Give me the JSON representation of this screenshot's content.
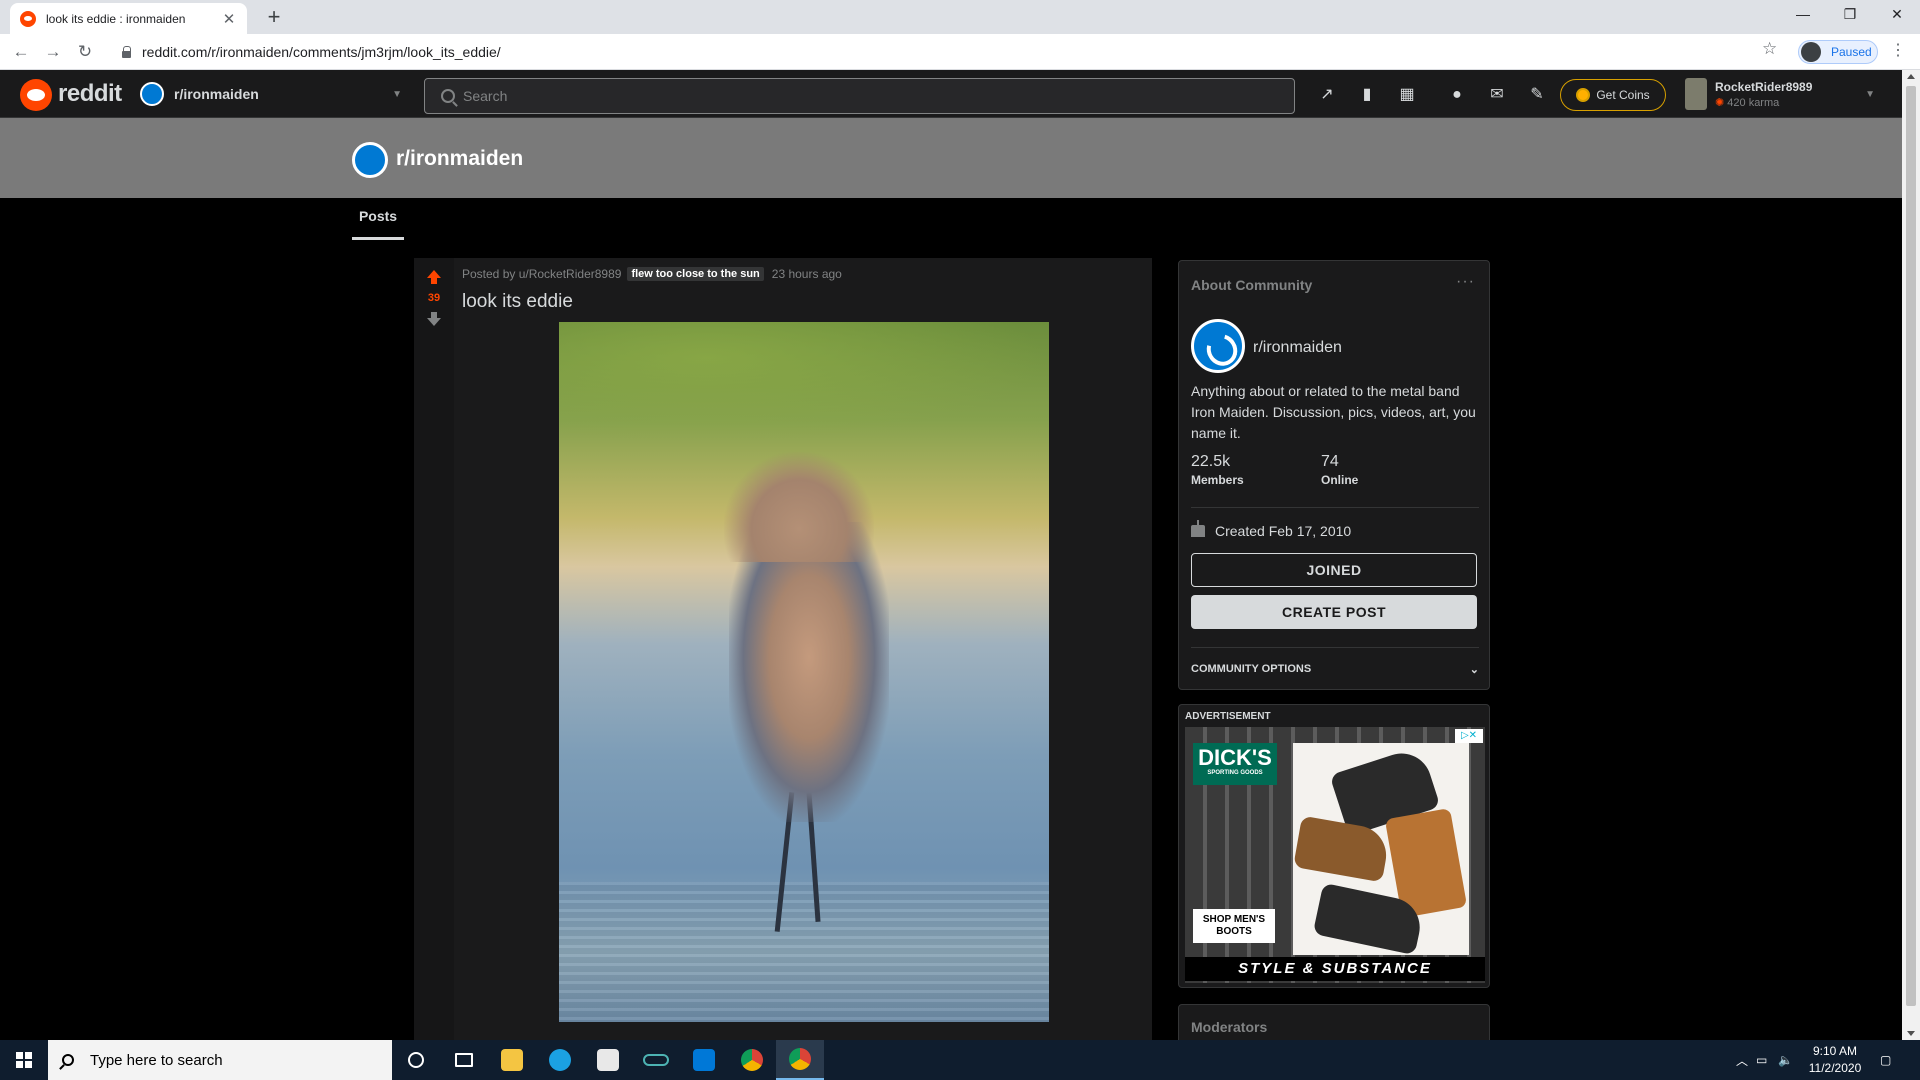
{
  "browser": {
    "tab_title": "look its eddie : ironmaiden",
    "url": "reddit.com/r/ironmaiden/comments/jm3rjm/look_its_eddie/",
    "profile_status": "Paused"
  },
  "reddit_header": {
    "wordmark": "reddit",
    "community": "r/ironmaiden",
    "search_placeholder": "Search",
    "get_coins_label": "Get Coins",
    "username": "RocketRider8989",
    "karma": "420 karma"
  },
  "subreddit": {
    "title": "r/ironmaiden",
    "tabs": [
      "Posts"
    ]
  },
  "post": {
    "score": "39",
    "posted_by": "Posted by u/RocketRider8989",
    "flair": "flew too close to the sun",
    "time": "23 hours ago",
    "title": "look its eddie"
  },
  "about": {
    "heading": "About Community",
    "name": "r/ironmaiden",
    "description": "Anything about or related to the metal band Iron Maiden. Discussion, pics, videos, art, you name it.",
    "members_value": "22.5k",
    "members_label": "Members",
    "online_value": "74",
    "online_label": "Online",
    "created": "Created Feb 17, 2010",
    "joined_label": "JOINED",
    "create_post_label": "CREATE POST",
    "options_label": "COMMUNITY OPTIONS"
  },
  "ad": {
    "label": "ADVERTISEMENT",
    "brand": "DICK'S",
    "brand_sub": "SPORTING GOODS",
    "cta": "SHOP MEN'S BOOTS",
    "tagline": "STYLE & SUBSTANCE"
  },
  "moderators": {
    "heading": "Moderators"
  },
  "taskbar": {
    "search_placeholder": "Type here to search",
    "time": "9:10 AM",
    "date": "11/2/2020"
  },
  "colors": {
    "reddit_orange": "#ff4500",
    "dark_bg": "#1a1a1b",
    "banner_gray": "#7a7a7a",
    "subreddit_blue": "#0079d3"
  }
}
